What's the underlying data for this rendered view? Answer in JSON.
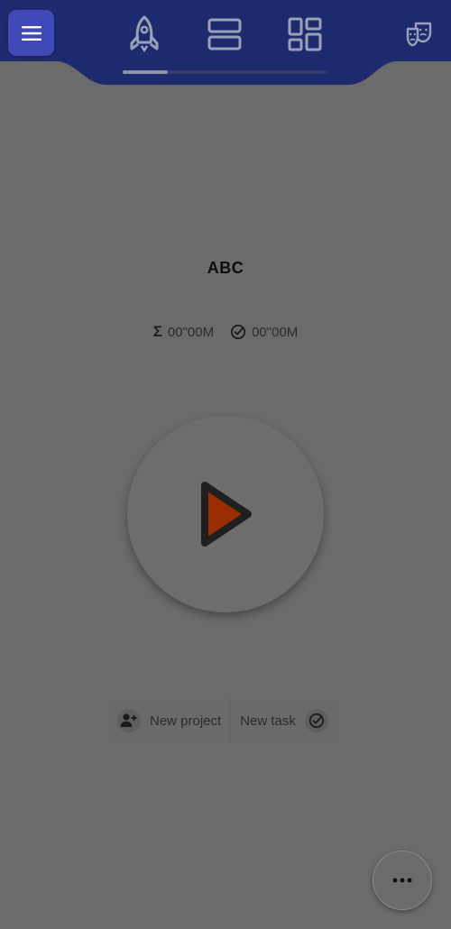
{
  "header": {
    "menu_icon": "hamburger-menu-icon",
    "tabs": [
      {
        "icon": "rocket-icon",
        "selected": true
      },
      {
        "icon": "stacked-rows-icon",
        "selected": false
      },
      {
        "icon": "dashboard-grid-icon",
        "selected": false
      }
    ],
    "profile_icon": "theater-masks-icon",
    "accent_color": "#1e2a6e",
    "menu_button_color": "#3f49b8"
  },
  "main": {
    "title": "ABC",
    "stats": {
      "total_time": "00\"00M",
      "target_time": "00\"00M",
      "total_icon": "sigma-icon",
      "target_icon": "target-icon"
    },
    "play_icon": "play-icon",
    "play_color": "#9a2e00"
  },
  "actions": {
    "new_project": "New project",
    "new_task": "New task"
  },
  "fab": {
    "icon": "more-dots-icon"
  }
}
